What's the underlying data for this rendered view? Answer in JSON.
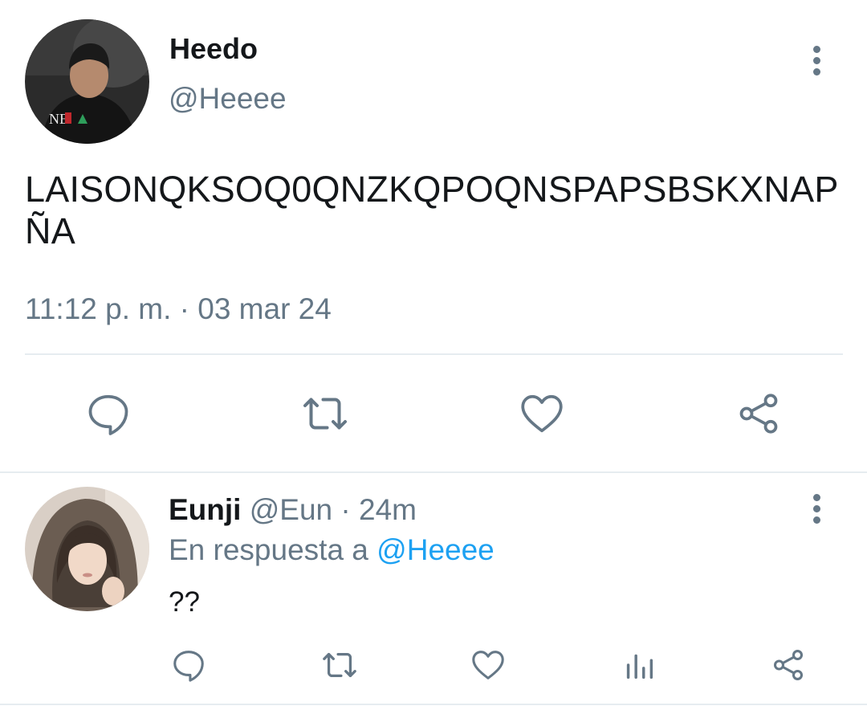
{
  "main_tweet": {
    "author": {
      "display_name": "Heedo",
      "handle": "@Heeee"
    },
    "text_line1": "LAISONQKSOQ0QNZKQPOQNSPAPSBSKXNAP",
    "text_line2": "ÑA",
    "timestamp": "11:12 p. m. · 03 mar 24",
    "actions": [
      "reply-icon",
      "retweet-icon",
      "like-icon",
      "share-icon"
    ]
  },
  "reply": {
    "author": {
      "display_name": "Eunji",
      "handle": "@Eun",
      "time": "· 24m"
    },
    "replying_prefix": "En respuesta a",
    "replying_to": "@Heeee",
    "text": "??",
    "actions": [
      "reply-icon",
      "retweet-icon",
      "like-icon",
      "analytics-icon",
      "share-icon"
    ]
  },
  "colors": {
    "icon_gray": "#657786",
    "link_blue": "#1da1f2",
    "divider": "#e6ecf0"
  }
}
